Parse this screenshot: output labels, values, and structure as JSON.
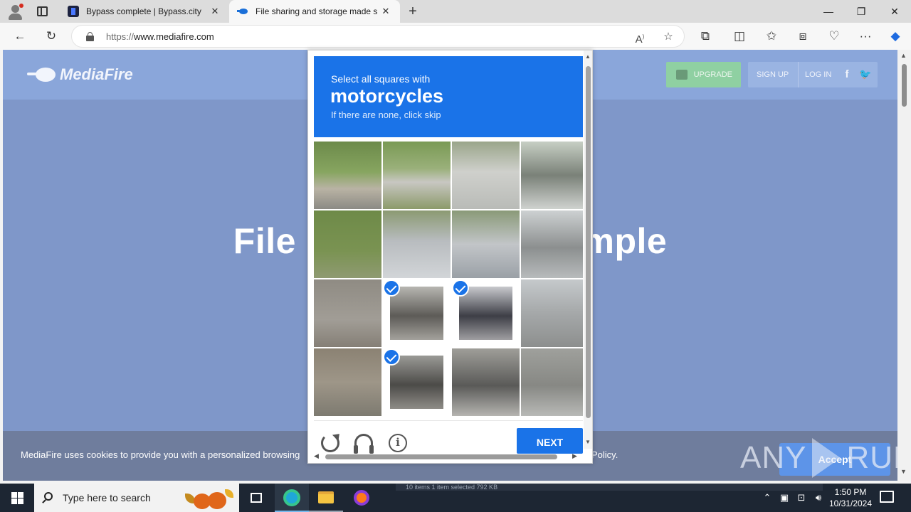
{
  "browser": {
    "tabs": [
      {
        "title": "Bypass complete | Bypass.city",
        "active": false
      },
      {
        "title": "File sharing and storage made simple",
        "active": true
      }
    ],
    "address": {
      "scheme": "https://",
      "host": "www.mediafire.com"
    }
  },
  "mediafire": {
    "logo_text": "MediaFire",
    "header": {
      "upgrade": "UPGRADE",
      "signup": "SIGN UP",
      "login": "LOG IN",
      "facebook": "f",
      "twitter": "🐦"
    },
    "hero": "File storage made simple",
    "cookie_text": "MediaFire uses cookies to provide you with a personalized browsing",
    "cookie_policy": "Policy.",
    "accept": "Accept"
  },
  "watermark": {
    "left": "ANY",
    "right": "RUN"
  },
  "captcha": {
    "instruction": "Select all squares with",
    "target": "motorcycles",
    "hint": "If there are none, click skip",
    "tiles": [
      {
        "selected": false
      },
      {
        "selected": false
      },
      {
        "selected": false
      },
      {
        "selected": false
      },
      {
        "selected": false
      },
      {
        "selected": false
      },
      {
        "selected": false
      },
      {
        "selected": false
      },
      {
        "selected": false
      },
      {
        "selected": true
      },
      {
        "selected": true
      },
      {
        "selected": false
      },
      {
        "selected": false
      },
      {
        "selected": true
      },
      {
        "selected": false
      },
      {
        "selected": false
      }
    ],
    "next_label": "NEXT"
  },
  "taskbar": {
    "search_placeholder": "Type here to search",
    "time": "1:50 PM",
    "date": "10/31/2024",
    "ghost_text": "10 items     1 item selected  792 KB"
  },
  "colors": {
    "captcha_blue": "#1a73e8",
    "page_bg": "#7f97c9",
    "taskbar": "#1d2633"
  }
}
